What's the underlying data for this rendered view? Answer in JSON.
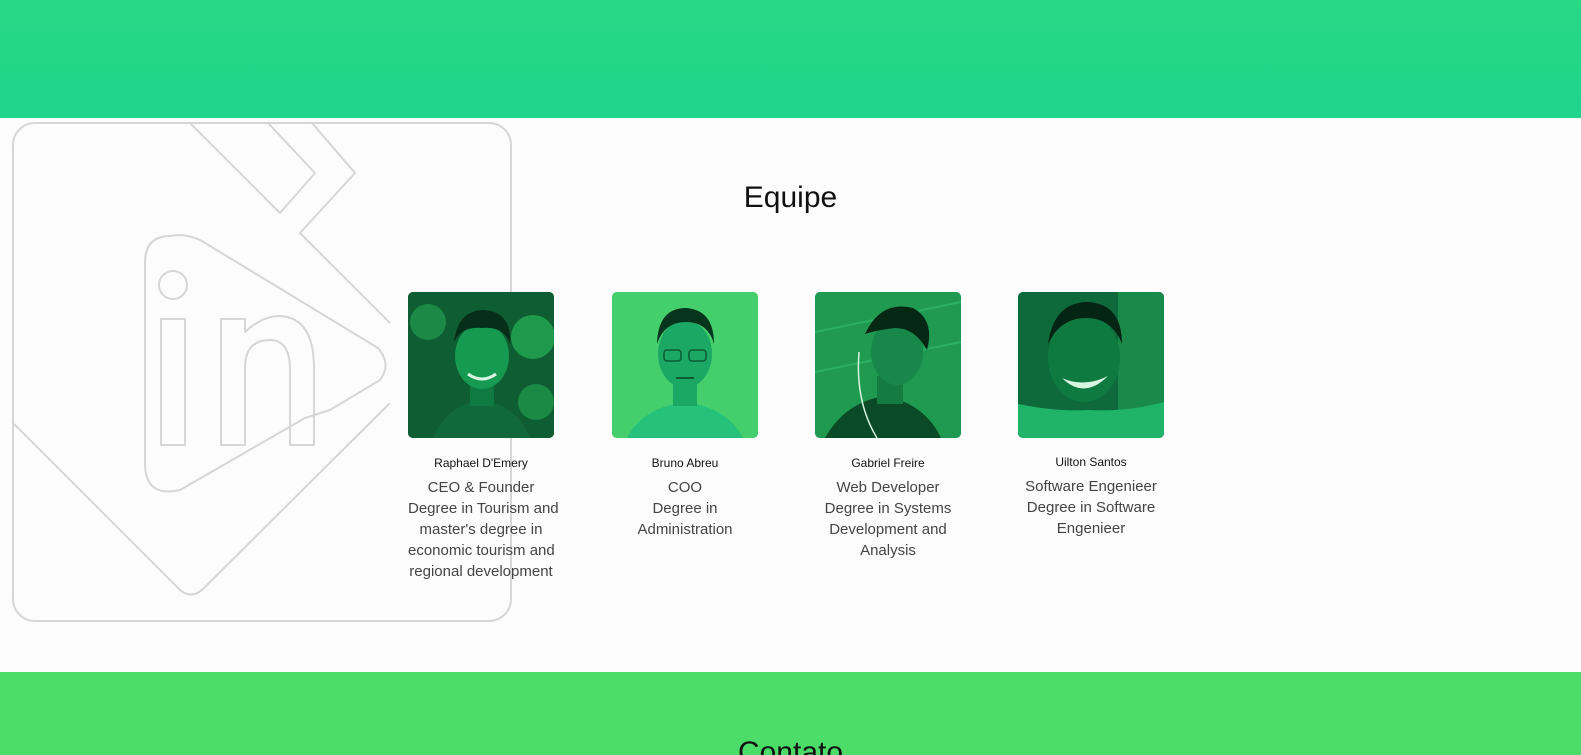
{
  "team": {
    "title": "Equipe",
    "members": [
      {
        "name": "Raphael D'Emery",
        "lines": [
          "CEO & Founder",
          "Degree in Tourism and",
          "master's degree in",
          "economic tourism and",
          "regional development"
        ],
        "photo_icon": "portrait-photo"
      },
      {
        "name": "Bruno Abreu",
        "lines": [
          "COO",
          "Degree in",
          "Administration"
        ],
        "photo_icon": "portrait-photo"
      },
      {
        "name": "Gabriel Freire",
        "lines": [
          "Web Developer",
          "Degree in Systems",
          "Development and",
          "Analysis"
        ],
        "photo_icon": "portrait-photo"
      },
      {
        "name": "Uilton Santos",
        "lines": [
          "Software Engenieer",
          "Degree in Software",
          "Engenieer"
        ],
        "photo_icon": "portrait-photo"
      }
    ]
  },
  "contact": {
    "title": "Contato"
  },
  "colors": {
    "top_band": "#22d68a",
    "contact_band": "#4cdd69",
    "photo_tint": "#1ecc7c",
    "background": "#fcfcfc"
  },
  "watermark_icon": "logo-outline-icon"
}
